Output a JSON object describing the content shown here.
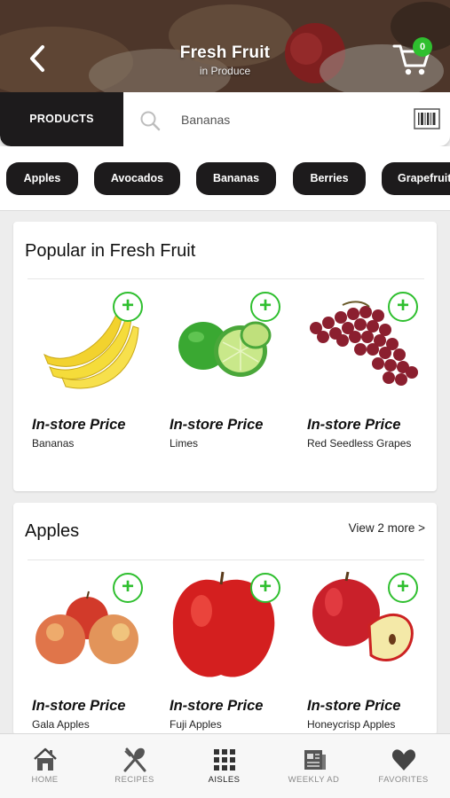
{
  "header": {
    "title": "Fresh Fruit",
    "subtitle": "in Produce",
    "cart_count": "0"
  },
  "searchbar": {
    "products_label": "PRODUCTS",
    "search_value": "Bananas"
  },
  "chips": [
    "Apples",
    "Avocados",
    "Bananas",
    "Berries",
    "Grapefruit"
  ],
  "popular": {
    "title": "Popular in Fresh Fruit",
    "products": [
      {
        "price": "In-store Price",
        "name": "Bananas"
      },
      {
        "price": "In-store Price",
        "name": "Limes"
      },
      {
        "price": "In-store Price",
        "name": "Red Seedless Grapes"
      }
    ]
  },
  "apples": {
    "title": "Apples",
    "view_more": "View 2 more >",
    "products": [
      {
        "price": "In-store Price",
        "name": "Gala Apples"
      },
      {
        "price": "In-store Price",
        "name": "Fuji Apples"
      },
      {
        "price": "In-store Price",
        "name": "Honeycrisp Apples Snacking"
      }
    ]
  },
  "nav": [
    {
      "label": "HOME",
      "icon": "home-icon"
    },
    {
      "label": "RECIPES",
      "icon": "recipes-icon"
    },
    {
      "label": "AISLES",
      "icon": "aisles-icon",
      "active": true
    },
    {
      "label": "WEEKLY AD",
      "icon": "weekly-ad-icon"
    },
    {
      "label": "FAVORITES",
      "icon": "favorites-icon"
    }
  ],
  "colors": {
    "accent_green": "#2fbf2f",
    "dark": "#1d1b1c",
    "background": "#ededed"
  }
}
